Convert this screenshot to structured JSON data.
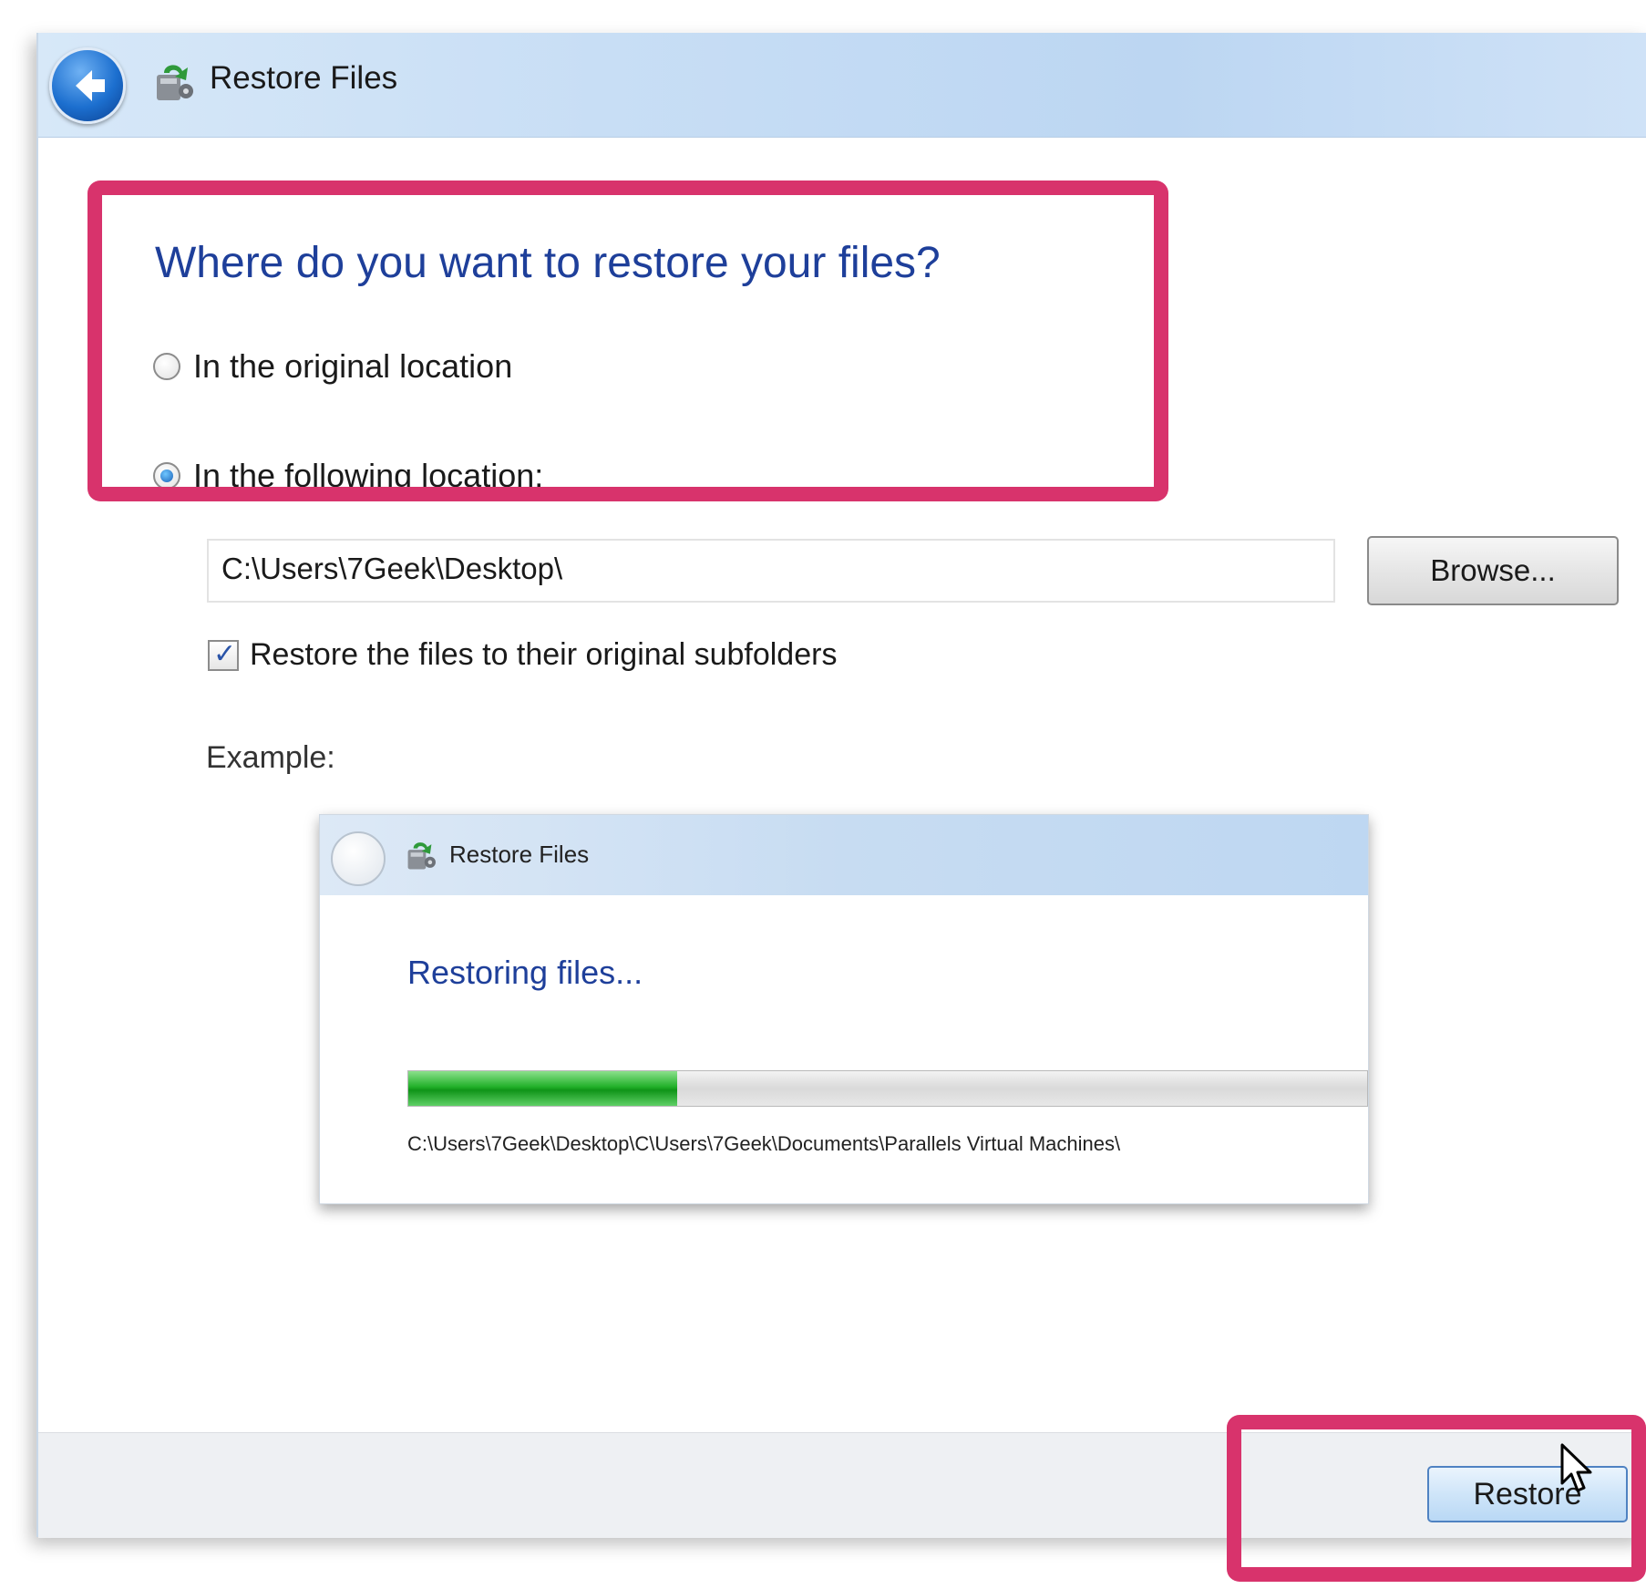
{
  "window": {
    "title": "Restore Files",
    "back_icon": "back-arrow-icon",
    "app_icon": "restore-files-icon"
  },
  "main": {
    "heading": "Where do you want to restore your files?",
    "options": [
      {
        "label": "In the original location",
        "selected": false
      },
      {
        "label": "In the following location:",
        "selected": true
      }
    ],
    "path_value": "C:\\Users\\7Geek\\Desktop\\",
    "browse_label": "Browse...",
    "checkbox_label": "Restore the files to their original subfolders",
    "checkbox_checked": true,
    "example_label": "Example:"
  },
  "example": {
    "title": "Restore Files",
    "heading": "Restoring files...",
    "progress_fraction": 0.28,
    "path": "C:\\Users\\7Geek\\Desktop\\C\\Users\\7Geek\\Documents\\Parallels Virtual Machines\\"
  },
  "footer": {
    "restore_label": "Restore"
  },
  "colors": {
    "highlight": "#d8336c",
    "heading": "#1e3f9a",
    "progress": "#22b02a"
  }
}
